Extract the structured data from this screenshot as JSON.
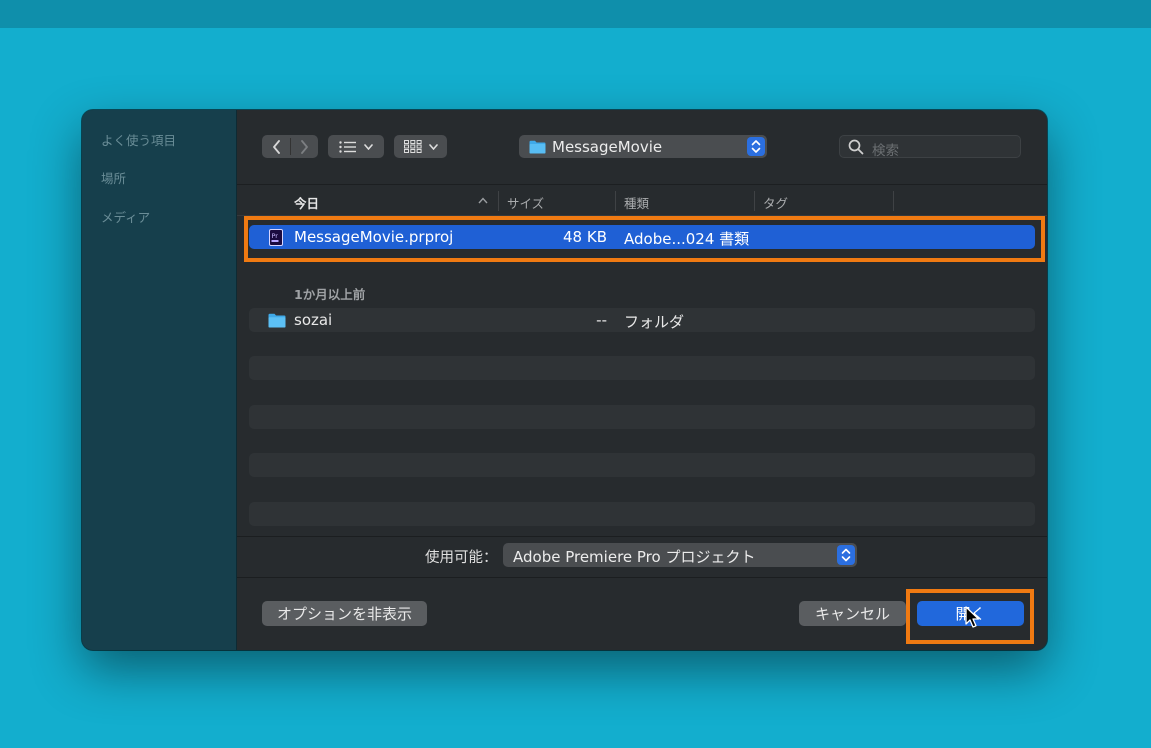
{
  "sidebar": {
    "sections": [
      "よく使う項目",
      "場所",
      "メディア"
    ]
  },
  "toolbar": {
    "back_icon": "chevron-left-icon",
    "forward_icon": "chevron-right-icon",
    "view_list_icon": "list-view-icon",
    "view_grid_icon": "icon-grid-view-icon",
    "location": "MessageMovie",
    "search_placeholder": "検索"
  },
  "columns": {
    "name": "今日",
    "size": "サイズ",
    "kind": "種類",
    "tags": "タグ"
  },
  "files_today": [
    {
      "name": "MessageMovie.prproj",
      "size": "48 KB",
      "kind": "Adobe...024 書類",
      "icon": "premiere-file-icon",
      "selected": true
    }
  ],
  "group_older": "1か月以上前",
  "files_older": [
    {
      "name": "sozai",
      "size": "--",
      "kind": "フォルダ",
      "icon": "folder-icon"
    }
  ],
  "format": {
    "label": "使用可能：",
    "value": "Adobe Premiere Pro プロジェクト"
  },
  "buttons": {
    "options": "オプションを非表示",
    "cancel": "キャンセル",
    "open": "開く"
  },
  "colors": {
    "background": "#13aece",
    "selection": "#1f60d5",
    "highlight": "#f07a12"
  }
}
